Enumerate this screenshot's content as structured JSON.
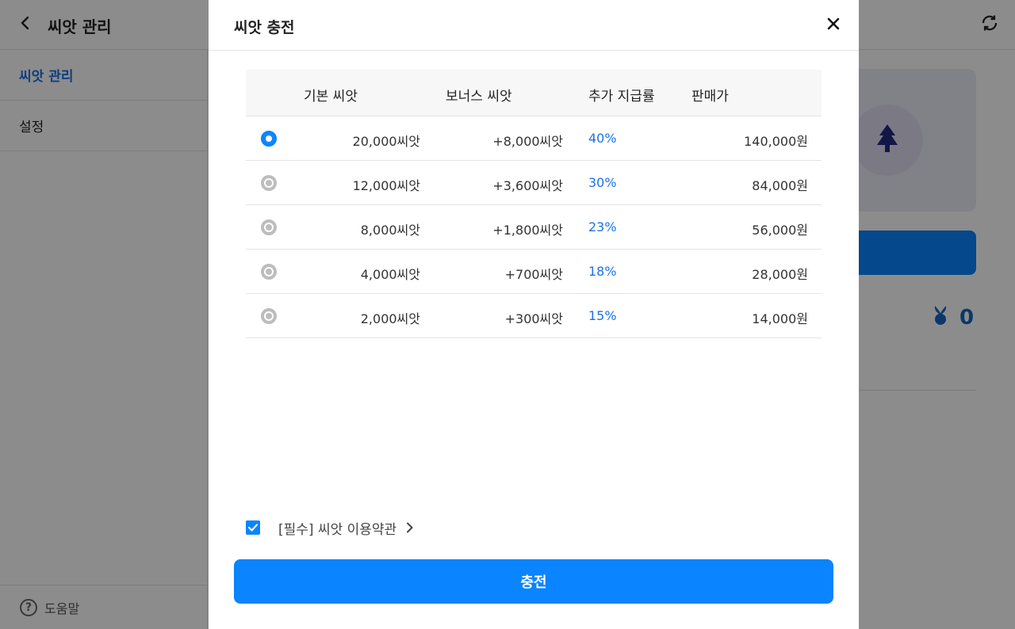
{
  "app": {
    "title": "씨앗 관리",
    "sidebar": [
      {
        "label": "씨앗 관리",
        "active": true
      },
      {
        "label": "설정",
        "active": false
      }
    ],
    "help_label": "도움말",
    "help_icon_glyph": "?",
    "seed_count": "0"
  },
  "modal": {
    "title": "씨앗 충전",
    "columns": [
      "기본 씨앗",
      "보너스 씨앗",
      "추가 지급률",
      "판매가"
    ],
    "rows": [
      {
        "base": "20,000씨앗",
        "bonus": "+8,000씨앗",
        "rate": "40%",
        "price": "140,000원",
        "selected": true
      },
      {
        "base": "12,000씨앗",
        "bonus": "+3,600씨앗",
        "rate": "30%",
        "price": "84,000원",
        "selected": false
      },
      {
        "base": "8,000씨앗",
        "bonus": "+1,800씨앗",
        "rate": "23%",
        "price": "56,000원",
        "selected": false
      },
      {
        "base": "4,000씨앗",
        "bonus": "+700씨앗",
        "rate": "18%",
        "price": "28,000원",
        "selected": false
      },
      {
        "base": "2,000씨앗",
        "bonus": "+300씨앗",
        "rate": "15%",
        "price": "14,000원",
        "selected": false
      }
    ],
    "agreement_label": "[필수] 씨앗 이용약관",
    "agreement_checked": true,
    "charge_label": "충전"
  },
  "colors": {
    "accent": "#0a84ff",
    "rate_text": "#1a73e8",
    "overlay": "rgba(0,0,0,0.45)"
  },
  "icons": {
    "back": "chevron-left-icon",
    "refresh": "refresh-icon",
    "close": "close-icon",
    "help": "help-circle-icon",
    "tree": "tree-icon",
    "seed": "seed-icon",
    "check": "check-icon",
    "chevron": "chevron-right-icon"
  }
}
